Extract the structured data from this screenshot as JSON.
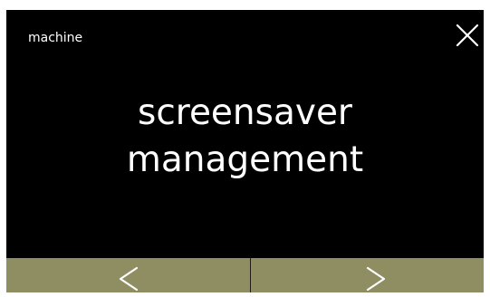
{
  "header": {
    "breadcrumb": "machine",
    "close_icon": "close-icon"
  },
  "main": {
    "title_line1": "screensaver",
    "title_line2": "management"
  },
  "nav": {
    "prev_icon": "chevron-left-icon",
    "next_icon": "chevron-right-icon"
  },
  "colors": {
    "screen_background": "#000000",
    "text": "#ffffff",
    "nav_bar": "#8f8e62",
    "divider": "#1e1e14"
  }
}
